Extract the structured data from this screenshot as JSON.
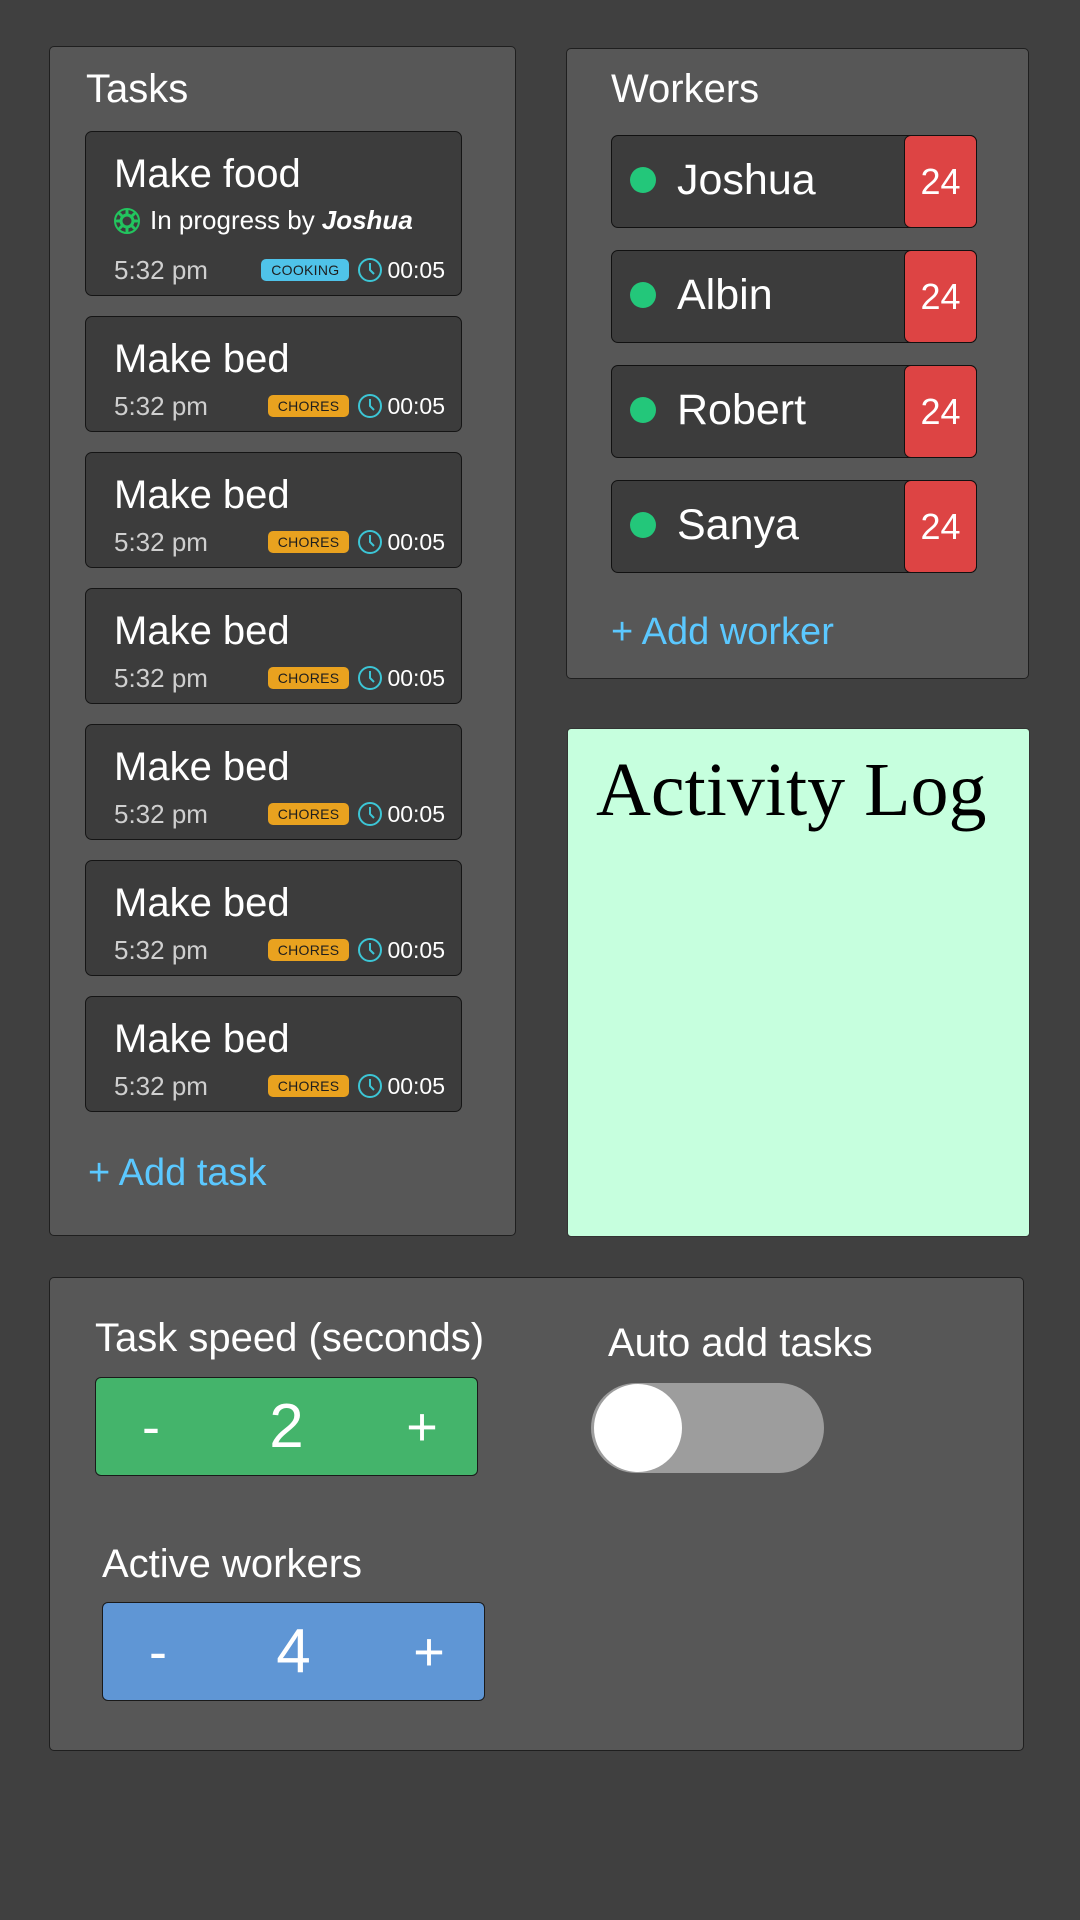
{
  "tasks_panel": {
    "title": "Tasks",
    "add_label": "+ Add task",
    "items": [
      {
        "title": "Make food",
        "status_prefix": "In progress by",
        "worker": "Joshua",
        "time": "5:32 pm",
        "tag": "COOKING",
        "duration": "00:05"
      },
      {
        "title": "Make bed",
        "time": "5:32 pm",
        "tag": "CHORES",
        "duration": "00:05"
      },
      {
        "title": "Make bed",
        "time": "5:32 pm",
        "tag": "CHORES",
        "duration": "00:05"
      },
      {
        "title": "Make bed",
        "time": "5:32 pm",
        "tag": "CHORES",
        "duration": "00:05"
      },
      {
        "title": "Make bed",
        "time": "5:32 pm",
        "tag": "CHORES",
        "duration": "00:05"
      },
      {
        "title": "Make bed",
        "time": "5:32 pm",
        "tag": "CHORES",
        "duration": "00:05"
      },
      {
        "title": "Make bed",
        "time": "5:32 pm",
        "tag": "CHORES",
        "duration": "00:05"
      }
    ]
  },
  "workers_panel": {
    "title": "Workers",
    "add_label": "+ Add worker",
    "items": [
      {
        "name": "Joshua",
        "count": "24"
      },
      {
        "name": "Albin",
        "count": "24"
      },
      {
        "name": "Robert",
        "count": "24"
      },
      {
        "name": "Sanya",
        "count": "24"
      }
    ]
  },
  "activity_log": {
    "title": "Activity Log"
  },
  "settings": {
    "task_speed": {
      "label": "Task speed (seconds)",
      "minus": "-",
      "value": "2",
      "plus": "+"
    },
    "auto_add": {
      "label": "Auto add tasks",
      "enabled": false
    },
    "active_workers": {
      "label": "Active workers",
      "minus": "-",
      "value": "4",
      "plus": "+"
    }
  },
  "colors": {
    "background": "#404040",
    "panel": "#575757",
    "card": "#3c3c3c",
    "link": "#5bc8ff",
    "cooking_tag": "#4fc3e9",
    "chores_tag": "#e9a21f",
    "worker_online": "#23c77a",
    "worker_count": "#dd4444",
    "activity_log_bg": "#c6ffde",
    "speed_stepper": "#44b46b",
    "workers_stepper": "#5f96d5",
    "toggle_off": "#9d9d9d"
  },
  "icons": {
    "status": "gear-icon",
    "duration": "clock-icon",
    "worker_status": "status-dot"
  }
}
